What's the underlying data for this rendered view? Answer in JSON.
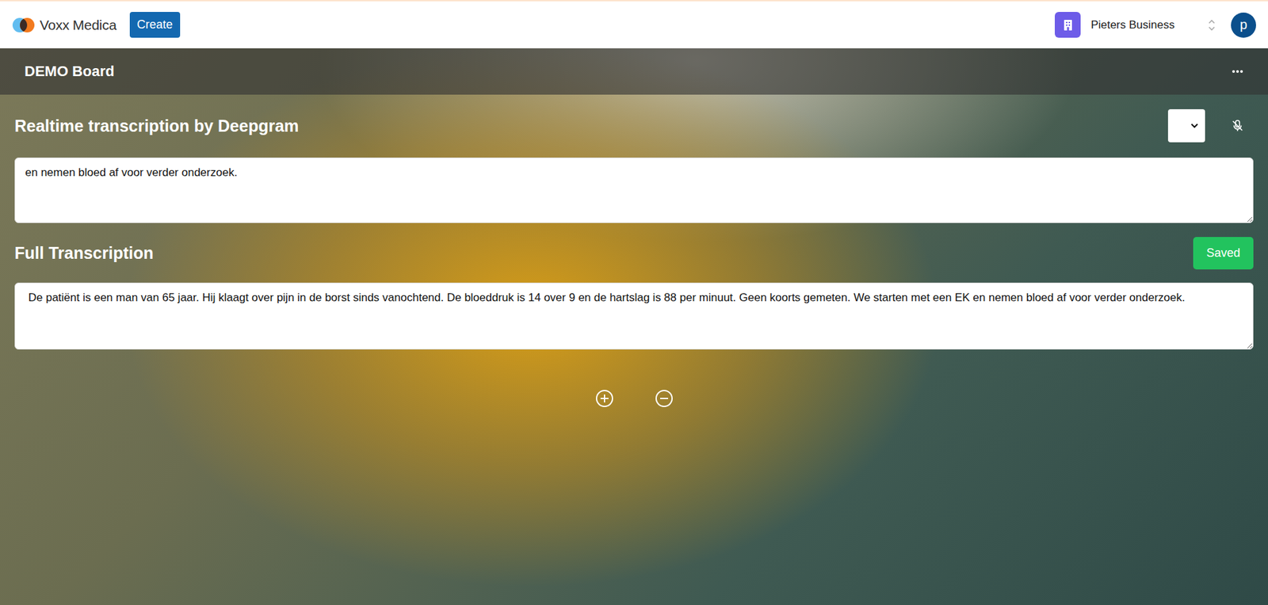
{
  "app": {
    "logo": "Voxx Medica",
    "create_button": "Create"
  },
  "org": {
    "name": "Pieters Business"
  },
  "user": {
    "avatar": "p"
  },
  "board": {
    "title": "DEMO Board"
  },
  "realtime": {
    "title": "Realtime transcription by Deepgram",
    "text": "en nemen bloed af voor verder onderzoek.",
    "mic_muted": true
  },
  "full": {
    "title": "Full Transcription",
    "text": " De patiënt is een man van 65 jaar. Hij klaagt over pijn in de borst sinds vanochtend. De bloeddruk is 14 over 9 en de hartslag is 88 per minuut. Geen koorts gemeten. We starten met een EK en nemen bloed af voor verder onderzoek.",
    "save_button": "Saved",
    "saved": true
  }
}
